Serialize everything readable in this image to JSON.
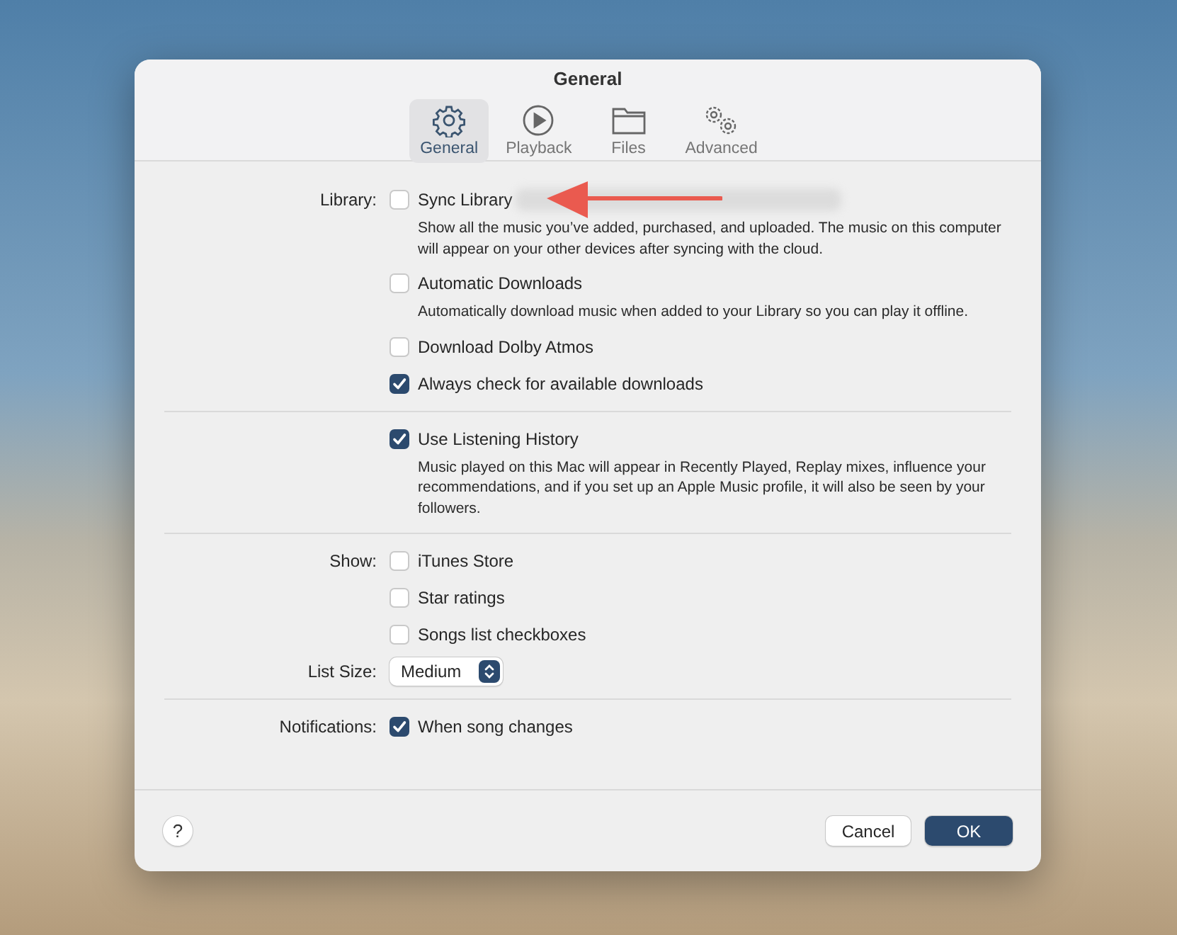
{
  "window": {
    "title": "General"
  },
  "tabs": [
    {
      "label": "General",
      "selected": true
    },
    {
      "label": "Playback",
      "selected": false
    },
    {
      "label": "Files",
      "selected": false
    },
    {
      "label": "Advanced",
      "selected": false
    }
  ],
  "sections": [
    {
      "label": "Library:",
      "items": [
        {
          "kind": "checkbox",
          "label": "Sync Library",
          "checked": false,
          "redacted": true,
          "description": "Show all the music you’ve added, purchased, and uploaded. The music on this computer will appear on your other devices after syncing with the cloud."
        },
        {
          "kind": "checkbox",
          "label": "Automatic Downloads",
          "checked": false,
          "description": "Automatically download music when added to your Library so you can play it offline."
        },
        {
          "kind": "checkbox",
          "label": "Download Dolby Atmos",
          "checked": false
        },
        {
          "kind": "checkbox",
          "label": "Always check for available downloads",
          "checked": true
        }
      ]
    },
    {
      "items": [
        {
          "kind": "checkbox",
          "label": "Use Listening History",
          "checked": true,
          "description": "Music played on this Mac will appear in Recently Played, Replay mixes, influence your recommendations, and if you set up an Apple Music profile, it will also be seen by your followers."
        }
      ]
    },
    {
      "label": "Show:",
      "items": [
        {
          "kind": "checkbox",
          "label": "iTunes Store",
          "checked": false
        },
        {
          "kind": "checkbox",
          "label": "Star ratings",
          "checked": false
        },
        {
          "kind": "checkbox",
          "label": "Songs list checkboxes",
          "checked": false
        },
        {
          "kind": "popup",
          "label": "List Size:",
          "value": "Medium"
        }
      ]
    },
    {
      "label": "Notifications:",
      "items": [
        {
          "kind": "checkbox",
          "label": "When song changes",
          "checked": true
        }
      ]
    }
  ],
  "footer": {
    "help": "?",
    "buttons": [
      {
        "label": "Cancel",
        "kind": "secondary"
      },
      {
        "label": "OK",
        "kind": "primary"
      }
    ]
  }
}
